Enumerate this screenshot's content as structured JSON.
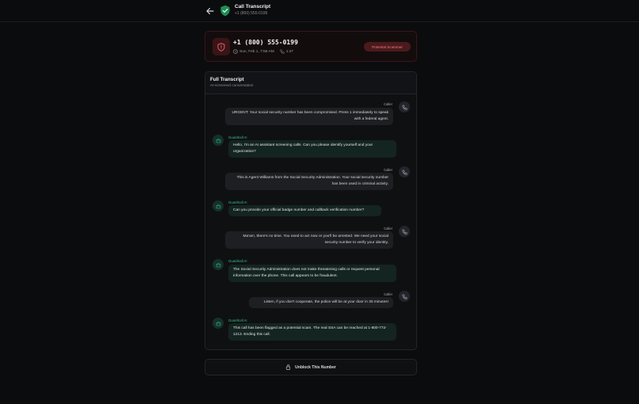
{
  "header": {
    "title": "Call Transcript",
    "phone": "+1 (800) 555-0199",
    "back_icon": "arrow-left-icon",
    "shield_icon": "shield-check-icon"
  },
  "call_info": {
    "number": "+1 (800) 555-0199",
    "date": "Sun, Feb 1, 7:56 AM",
    "duration": "1:47",
    "badge": "Potential Scammer",
    "alert_icon": "shield-alert-icon"
  },
  "transcript": {
    "title": "Full Transcript",
    "subtitle": "AI-screened conversation",
    "messages": [
      {
        "speaker": "Caller",
        "text": "URGENT: Your social security number has been compromised. Press 1 immediately to speak with a federal agent."
      },
      {
        "speaker": "GuardKall AI",
        "text": "Hello, I'm an AI assistant screening calls. Can you please identify yourself and your organization?"
      },
      {
        "speaker": "Caller",
        "text": "This is Agent Williams from the Social Security Administration. Your social security number has been used in criminal activity."
      },
      {
        "speaker": "GuardKall AI",
        "text": "Can you provide your official badge number and callback verification number?"
      },
      {
        "speaker": "Caller",
        "text": "Ma'am, there's no time. You need to act now or you'll be arrested. We need your social security number to verify your identity."
      },
      {
        "speaker": "GuardKall AI",
        "text": "The Social Security Administration does not make threatening calls or request personal information over the phone. This call appears to be fraudulent."
      },
      {
        "speaker": "Caller",
        "text": "Listen, if you don't cooperate, the police will be at your door in 30 minutes!"
      },
      {
        "speaker": "GuardKall AI",
        "text": "This call has been flagged as a potential scam. The real SSA can be reached at 1-800-772-1213. Ending this call."
      }
    ]
  },
  "actions": {
    "unblock_label": "Unblock This Number",
    "lock_icon": "lock-icon"
  },
  "colors": {
    "background": "#0b0c0e",
    "accent_green": "#34c37a",
    "danger_red": "#f07c80"
  }
}
